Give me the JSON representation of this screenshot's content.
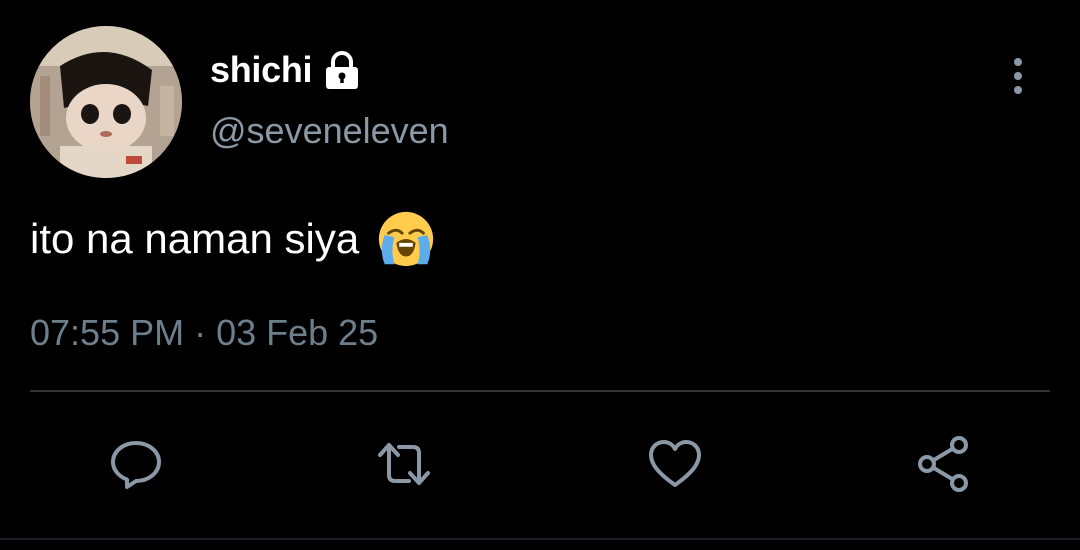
{
  "user": {
    "display_name": "shichi",
    "handle": "@seveneleven",
    "protected_icon": "lock-icon",
    "avatar": "avatar-photo"
  },
  "tweet": {
    "text": "ito na naman siya",
    "emoji": "loudly-crying-face-emoji",
    "timestamp": "07:55 PM · 03 Feb 25"
  },
  "actions": [
    {
      "icon": "reply-icon"
    },
    {
      "icon": "retweet-icon"
    },
    {
      "icon": "like-icon"
    },
    {
      "icon": "share-icon"
    }
  ],
  "menu": {
    "icon": "more-vertical-icon"
  },
  "colors": {
    "background": "#000000",
    "text_primary": "#ffffff",
    "text_secondary": "#8b98a5",
    "icon_gray": "#8b98a5",
    "divider": "#2f3336"
  }
}
